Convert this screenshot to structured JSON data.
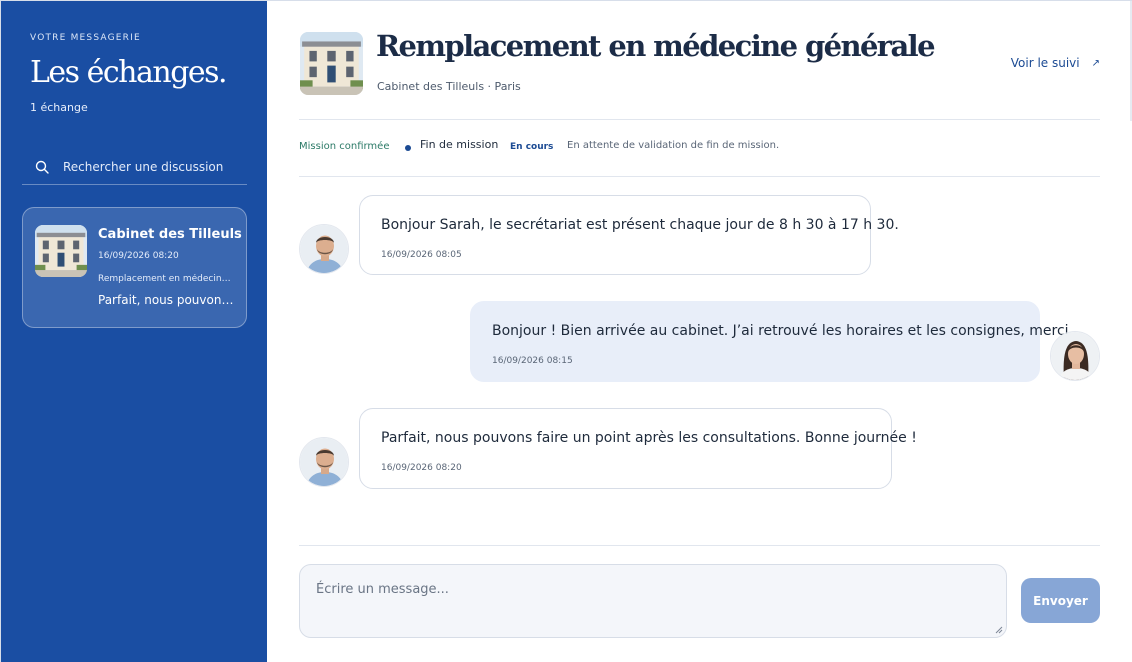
{
  "sidebar": {
    "eyebrow": "VOTRE MESSAGERIE",
    "title": "Les échanges.",
    "count": "1 échange",
    "search_placeholder": "Rechercher une discussion",
    "conversations": [
      {
        "name": "Cabinet des Tilleuls",
        "date": "16/09/2026 08:20",
        "mission": "Remplacement en médecine générale",
        "last_message": "Parfait, nous pouvons faire un point après les consultations. Bonne journée !"
      }
    ]
  },
  "header": {
    "title": "Remplacement en médecine générale",
    "subtitle": "Cabinet des Tilleuls · Paris",
    "follow_label": "Voir le suivi",
    "follow_arrow": "↗"
  },
  "status": {
    "confirmed": "Mission confirmée",
    "step": "Fin de mission",
    "badge": "En cours",
    "note": "En attente de validation de fin de mission."
  },
  "messages": [
    {
      "author": "cabinet",
      "text": "Bonjour Sarah, le secrétariat est présent chaque jour de 8 h 30 à 17 h 30.",
      "time": "16/09/2026 08:05"
    },
    {
      "author": "me",
      "text": "Bonjour ! Bien arrivée au cabinet. J’ai retrouvé les horaires et les consignes, merci.",
      "time": "16/09/2026 08:15"
    },
    {
      "author": "cabinet",
      "text": "Parfait, nous pouvons faire un point après les consultations. Bonne journée !",
      "time": "16/09/2026 08:20"
    }
  ],
  "composer": {
    "placeholder": "Écrire un message...",
    "send_label": "Envoyer"
  },
  "colors": {
    "sidebar_bg": "#1a4ea3",
    "accent": "#1b4a93",
    "confirmed": "#2c7a67",
    "own_bubble": "#e8eef9",
    "send_button": "#87a6d6"
  },
  "icons": {
    "search": "search-icon",
    "external_link": "external-link-icon"
  }
}
